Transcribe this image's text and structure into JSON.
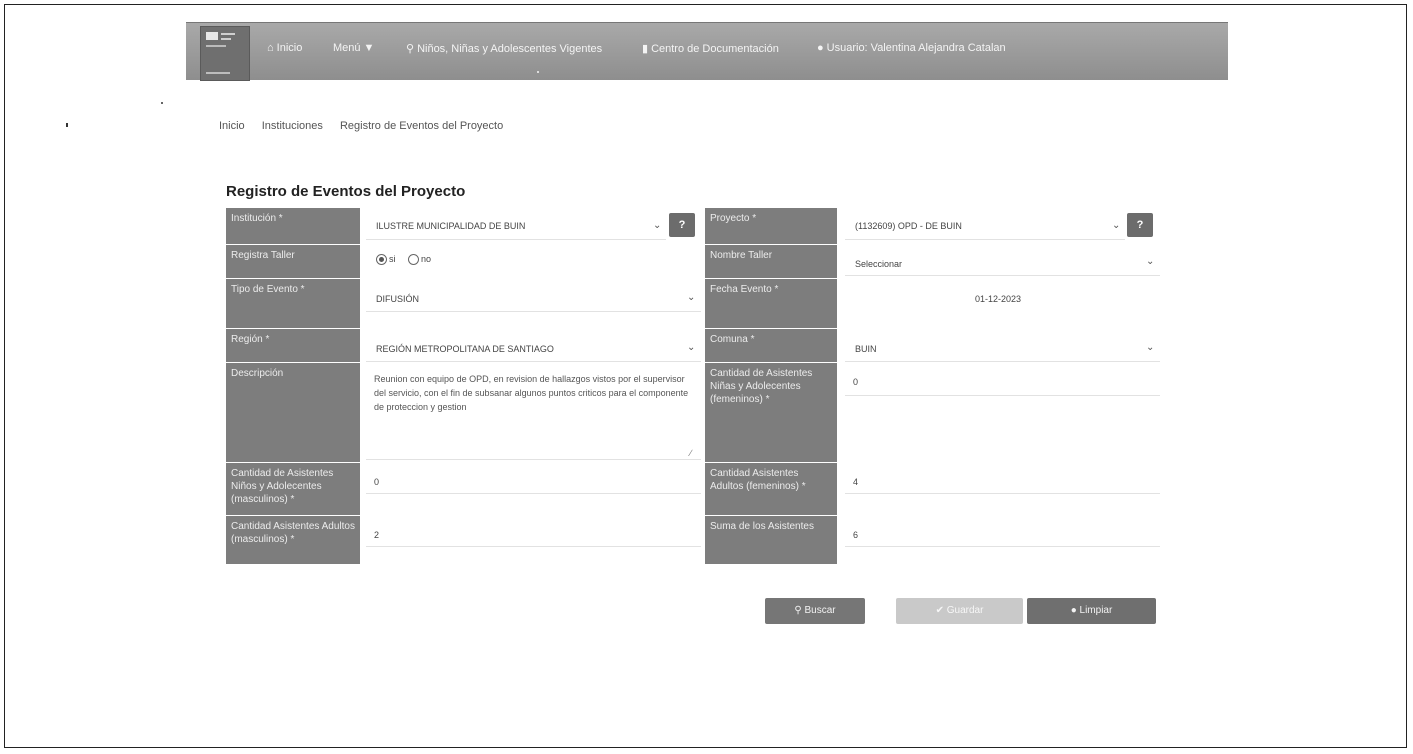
{
  "nav": {
    "inicio": "Inicio",
    "menu": "Menú",
    "ninos": "Niños, Niñas y Adolescentes Vigentes",
    "centro": "Centro de Documentación",
    "usuario": "Usuario: Valentina Alejandra Catalan"
  },
  "breadcrumb": [
    "Inicio",
    "Instituciones",
    "Registro de Eventos del Proyecto"
  ],
  "page_title": "Registro de Eventos del Proyecto",
  "form": {
    "institucion": {
      "label": "Institución *",
      "value": "ILUSTRE MUNICIPALIDAD DE BUIN"
    },
    "proyecto": {
      "label": "Proyecto *",
      "value": "(1132609) OPD - DE BUIN"
    },
    "registra_taller": {
      "label": "Registra Taller",
      "opt_si": "si",
      "opt_no": "no",
      "selected": "si"
    },
    "nombre_taller": {
      "label": "Nombre Taller",
      "value": "Seleccionar"
    },
    "tipo_evento": {
      "label": "Tipo de Evento *",
      "value": "DIFUSIÓN"
    },
    "fecha_evento": {
      "label": "Fecha Evento *",
      "value": "01-12-2023"
    },
    "region": {
      "label": "Región *",
      "value": "REGIÓN METROPOLITANA DE SANTIAGO"
    },
    "comuna": {
      "label": "Comuna *",
      "value": "BUIN"
    },
    "descripcion": {
      "label": "Descripción",
      "value": "Reunion con equipo de OPD, en revision de hallazgos vistos por el supervisor del servicio, con el fin de subsanar algunos puntos criticos para el componente de proteccion y gestion"
    },
    "asist_ninas": {
      "label": "Cantidad de Asistentes Niñas y Adolecentes (femeninos) *",
      "value": "0"
    },
    "asist_ninos": {
      "label": "Cantidad de Asistentes Niños y Adolecentes (masculinos) *",
      "value": "0"
    },
    "adultos_fem": {
      "label": "Cantidad Asistentes Adultos (femeninos) *",
      "value": "4"
    },
    "adultos_masc": {
      "label": "Cantidad Asistentes Adultos (masculinos) *",
      "value": "2"
    },
    "suma": {
      "label": "Suma de los Asistentes",
      "value": "6"
    }
  },
  "buttons": {
    "buscar": "Buscar",
    "guardar": "Guardar",
    "limpiar": "Limpiar"
  },
  "icons": {
    "home": "home-icon",
    "menu": "caret-down-icon",
    "search": "search-icon",
    "doc": "document-icon",
    "user": "user-icon",
    "help": "question-icon",
    "check": "check-icon",
    "clear": "circle-icon"
  },
  "colors": {
    "navbar": "#9b9b9b",
    "label_bg": "#7d7d7d",
    "button": "#767676",
    "button_disabled": "#c9c9c9"
  }
}
